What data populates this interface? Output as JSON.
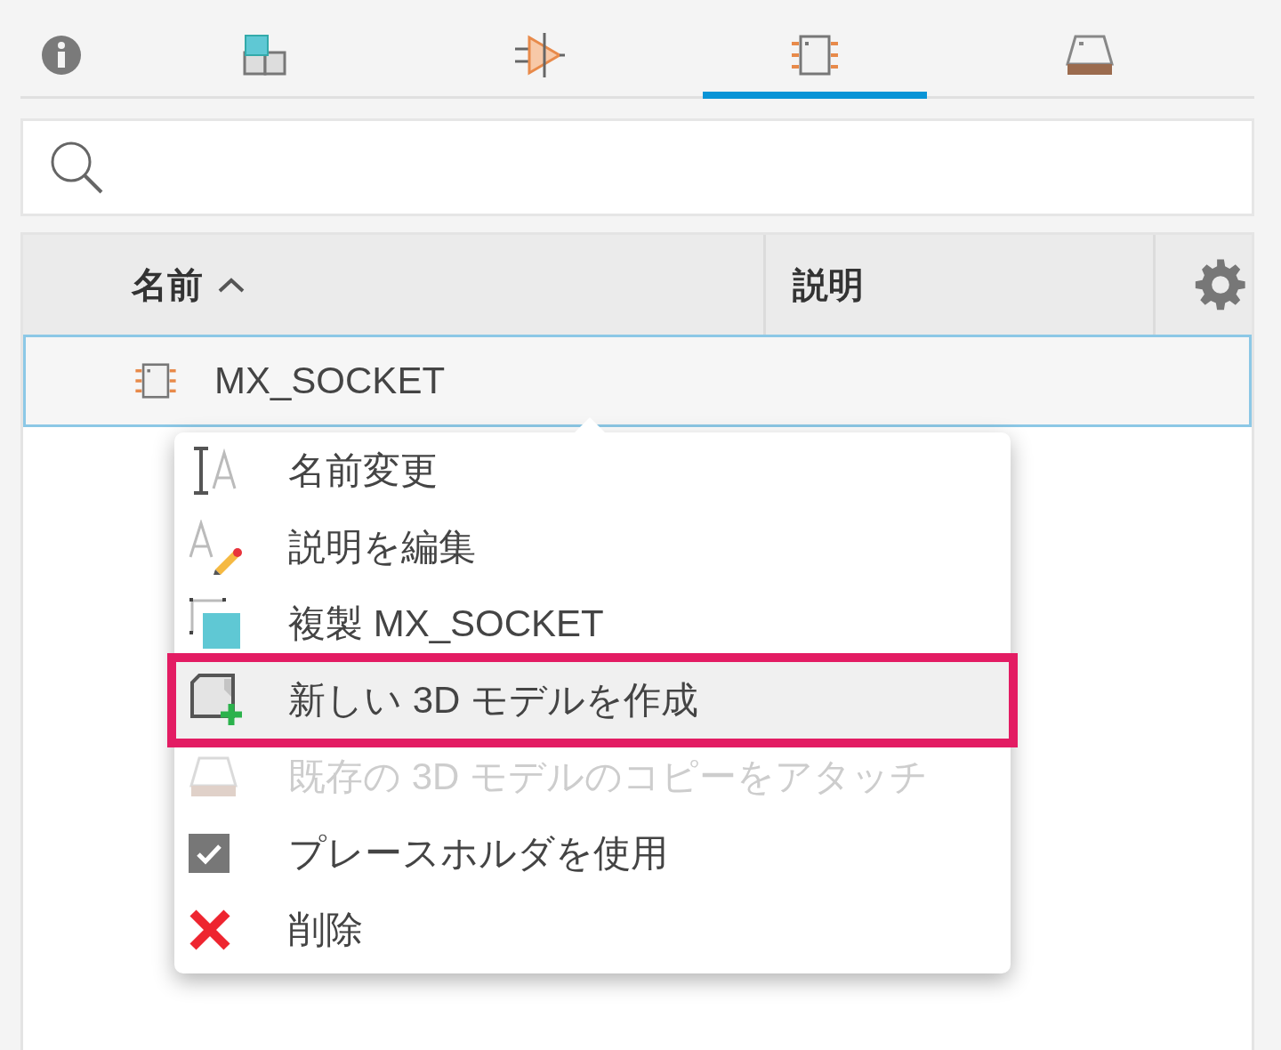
{
  "tabs": [
    {
      "kind": "info",
      "selected": false
    },
    {
      "kind": "blocks",
      "selected": false
    },
    {
      "kind": "symbol",
      "selected": false
    },
    {
      "kind": "chip",
      "selected": true
    },
    {
      "kind": "model",
      "selected": false
    }
  ],
  "table": {
    "columns": [
      {
        "label": "名前",
        "sorted": true
      },
      {
        "label": "説明",
        "sorted": false
      }
    ],
    "rows": [
      {
        "name": "MX_SOCKET",
        "selected": true
      }
    ]
  },
  "context_menu": {
    "items": [
      {
        "kind": "rename",
        "label": "名前変更",
        "disabled": false,
        "annotated": false
      },
      {
        "kind": "edit-description",
        "label": "説明を編集",
        "disabled": false,
        "annotated": false
      },
      {
        "kind": "duplicate",
        "label": "複製 MX_SOCKET",
        "disabled": false,
        "annotated": false
      },
      {
        "kind": "new-model",
        "label": "新しい 3D モデルを作成",
        "disabled": false,
        "annotated": true
      },
      {
        "kind": "attach-model",
        "label": "既存の 3D モデルのコピーをアタッチ",
        "disabled": true,
        "annotated": false
      },
      {
        "kind": "placeholder",
        "label": "プレースホルダを使用",
        "disabled": false,
        "annotated": false
      },
      {
        "kind": "delete",
        "label": "削除",
        "disabled": false,
        "annotated": false
      }
    ]
  }
}
